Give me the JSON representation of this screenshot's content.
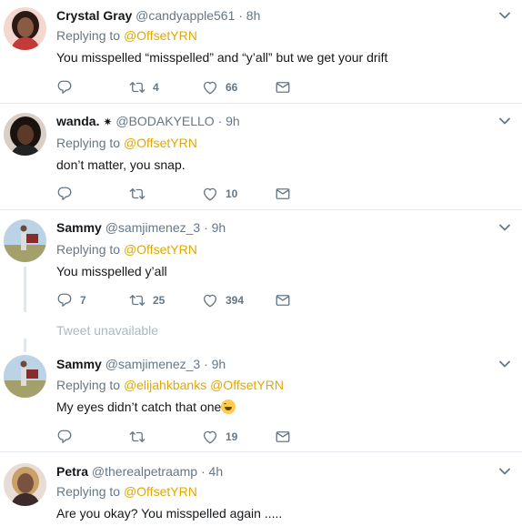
{
  "tweets": [
    {
      "name": "Crystal Gray",
      "handle": "@candyapple561",
      "time": "· 8h",
      "replying_prefix": "Replying to",
      "replying_to": "@OffsetYRN",
      "text": "You misspelled “misspelled” and “y’all” but we get your drift",
      "reply_count": "",
      "retweet_count": "4",
      "like_count": "66"
    },
    {
      "name": "wanda.",
      "badge": "✷",
      "handle": "@BODAKYELLO",
      "time": "· 9h",
      "replying_prefix": "Replying to",
      "replying_to": "@OffsetYRN",
      "text": "don’t matter, you snap.",
      "reply_count": "",
      "retweet_count": "",
      "like_count": "10"
    },
    {
      "name": "Sammy",
      "handle": "@samjimenez_3",
      "time": "· 9h",
      "replying_prefix": "Replying to",
      "replying_to": "@OffsetYRN",
      "text": "You misspelled y’all",
      "reply_count": "7",
      "retweet_count": "25",
      "like_count": "394"
    },
    {
      "name": "Sammy",
      "handle": "@samjimenez_3",
      "time": "· 9h",
      "replying_prefix": "Replying to",
      "replying_to": "@elijahkbanks @OffsetYRN",
      "text": "My eyes didn’t catch that one",
      "reply_count": "",
      "retweet_count": "",
      "like_count": "19"
    },
    {
      "name": "Petra",
      "handle": "@therealpetraamp",
      "time": "· 4h",
      "replying_prefix": "Replying to",
      "replying_to": "@OffsetYRN",
      "text": "Are you okay? You misspelled again .....",
      "reply_count": "",
      "retweet_count": "",
      "like_count": ""
    }
  ],
  "unavailable_text": "Tweet unavailable",
  "colors": {
    "mention": "#e0a800",
    "secondary": "#657786",
    "divider": "#e6ecf0",
    "thread_line": "#e1e8ed"
  },
  "icons": [
    "reply-icon",
    "retweet-icon",
    "like-icon",
    "direct-message-icon",
    "chevron-down-icon",
    "tears-of-joy-emoji"
  ]
}
